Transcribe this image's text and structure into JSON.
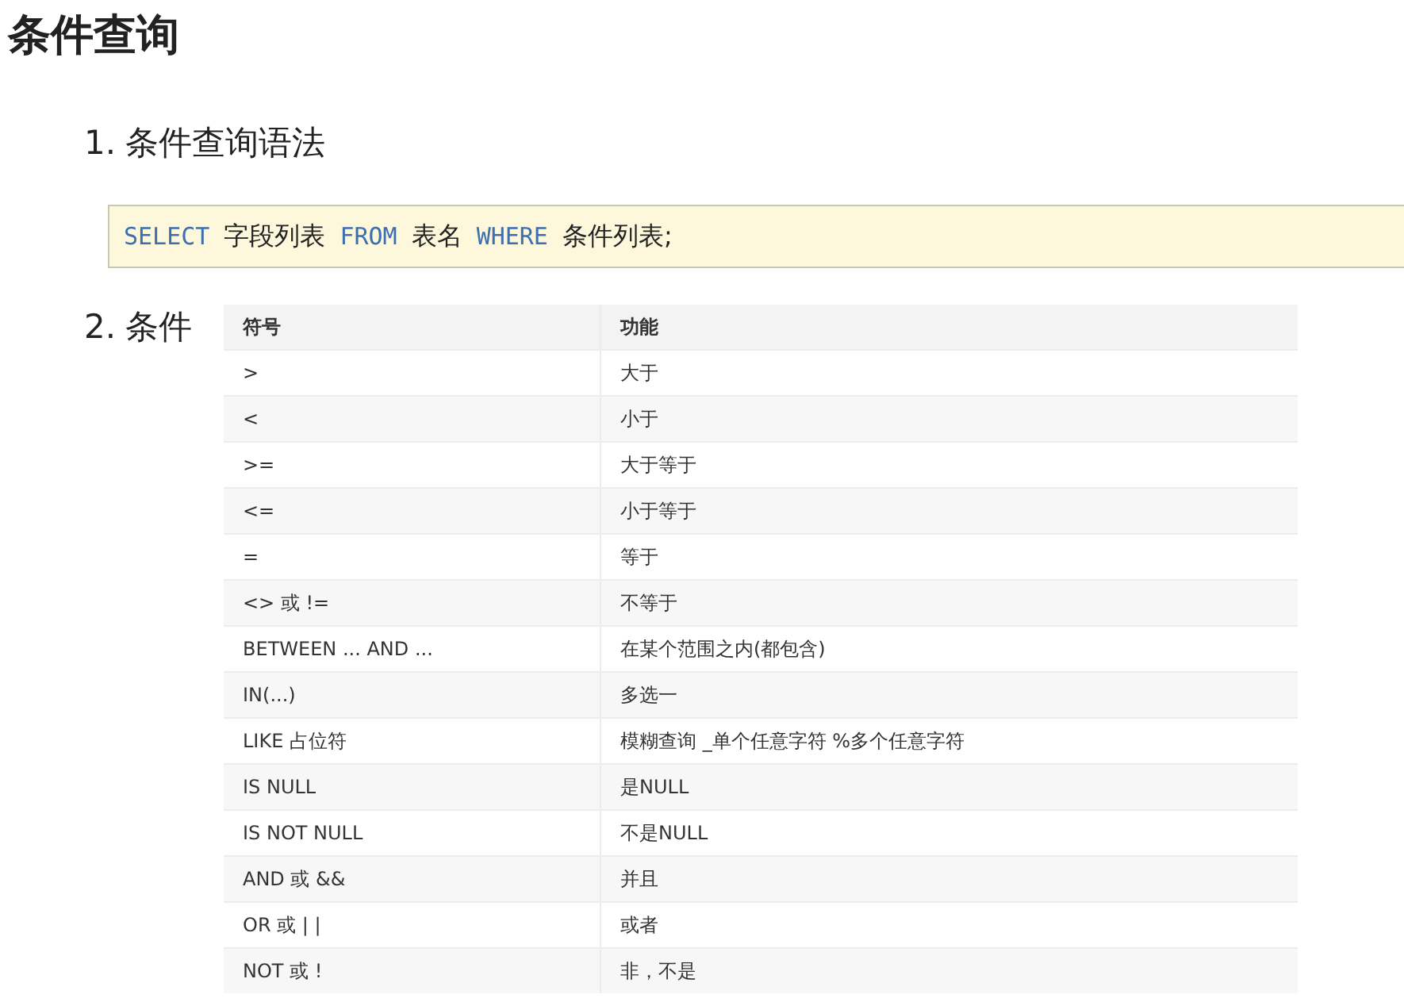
{
  "title": "条件查询",
  "sections": [
    {
      "number": "1.",
      "heading": "条件查询语法",
      "kind": "code",
      "code": [
        {
          "kind": "keyword",
          "text": "SELECT"
        },
        {
          "kind": "text",
          "text": "字段列表"
        },
        {
          "kind": "keyword",
          "text": "FROM"
        },
        {
          "kind": "text",
          "text": "表名"
        },
        {
          "kind": "keyword",
          "text": "WHERE"
        },
        {
          "kind": "text",
          "text": "条件列表;"
        }
      ]
    },
    {
      "number": "2.",
      "heading": "条件",
      "kind": "table",
      "columns": [
        "符号",
        "功能"
      ],
      "rows": [
        [
          ">",
          "大于"
        ],
        [
          "<",
          "小于"
        ],
        [
          ">=",
          "大于等于"
        ],
        [
          "<=",
          "小于等于"
        ],
        [
          "=",
          "等于"
        ],
        [
          "<> 或 !=",
          "不等于"
        ],
        [
          "BETWEEN ... AND ...",
          "在某个范围之内(都包含)"
        ],
        [
          "IN(...)",
          "多选一"
        ],
        [
          "LIKE 占位符",
          "模糊查询  _单个任意字符  %多个任意字符"
        ],
        [
          "IS NULL",
          "是NULL"
        ],
        [
          "IS NOT NULL",
          "不是NULL"
        ],
        [
          "AND 或 &&",
          "并且"
        ],
        [
          "OR 或 | |",
          "或者"
        ],
        [
          "NOT 或 !",
          "非，不是"
        ]
      ]
    }
  ]
}
